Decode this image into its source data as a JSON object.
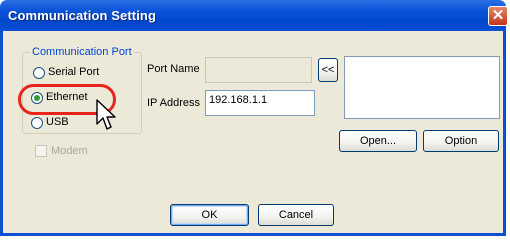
{
  "window": {
    "title": "Communication Setting"
  },
  "comm_port": {
    "group_label": "Communication Port",
    "options": [
      {
        "label": "Serial Port",
        "selected": false
      },
      {
        "label": "Ethernet",
        "selected": true
      },
      {
        "label": "USB",
        "selected": false
      }
    ]
  },
  "modem": {
    "label": "Modem",
    "checked": false,
    "enabled": false
  },
  "port_name": {
    "label": "Port Name",
    "value": ""
  },
  "browse_button": {
    "label": "<<"
  },
  "ip_address": {
    "label": "IP Address",
    "value": "192.168.1.1"
  },
  "buttons": {
    "open": "Open...",
    "option": "Option",
    "ok": "OK",
    "cancel": "Cancel"
  },
  "colors": {
    "title_bar": "#0a4fd4",
    "highlight": "#e8241c",
    "group_label": "#0046d5"
  },
  "icons": {
    "close": "close-icon",
    "cursor": "mouse-pointer-icon"
  }
}
